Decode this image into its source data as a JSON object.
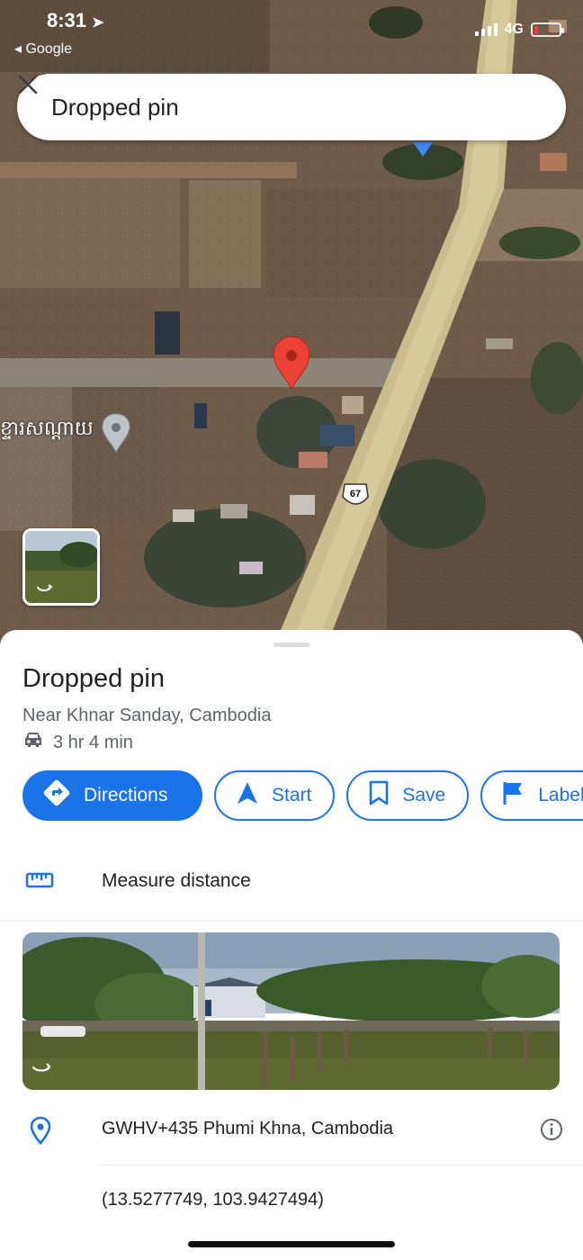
{
  "status_bar": {
    "time": "8:31",
    "back_app": "◂ Google",
    "network": "4G"
  },
  "search": {
    "value": "Dropped pin"
  },
  "map": {
    "place_label": "ខ្ទារសណ្តាយ",
    "route_shield": "67"
  },
  "place": {
    "title": "Dropped pin",
    "subtitle": "Near Khnar Sanday, Cambodia",
    "drive_time": "3 hr 4 min"
  },
  "actions": {
    "directions": "Directions",
    "start": "Start",
    "save": "Save",
    "label": "Label"
  },
  "measure_distance": "Measure distance",
  "address": "GWHV+435 Phumi Khna, Cambodia",
  "coordinates": "(13.5277749, 103.9427494)",
  "colors": {
    "accent": "#1a73e8",
    "pin_red": "#ea4335",
    "text_primary": "#202124",
    "text_secondary": "#5f6368"
  }
}
